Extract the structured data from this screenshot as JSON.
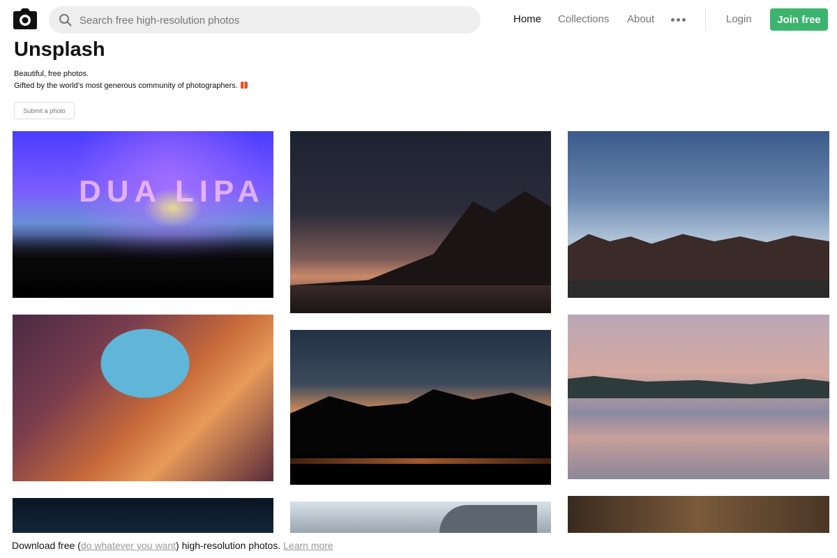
{
  "brand": {
    "icon": "camera-icon"
  },
  "search": {
    "placeholder": "Search free high-resolution photos",
    "icon": "search-icon"
  },
  "nav": {
    "home": "Home",
    "collections": "Collections",
    "about": "About",
    "more_icon": "more-dots-icon",
    "login": "Login",
    "join": "Join free"
  },
  "hero": {
    "title": "Unsplash",
    "line1": "Beautiful, free photos.",
    "line2": "Gifted by the world’s most generous community of photographers.",
    "gift_icon": "gift-icon",
    "submit": "Submit a photo"
  },
  "photos": [
    {
      "subject": "concert-crowd",
      "overlay_text": "DUA LIPA"
    },
    {
      "subject": "milky-way-mountain-lake"
    },
    {
      "subject": "starry-sky-treeline"
    },
    {
      "subject": "antelope-canyon-arch"
    },
    {
      "subject": "mountain-silhouette-sunset-reflection"
    },
    {
      "subject": "lake-bled-island-church"
    },
    {
      "subject": "night-sky"
    },
    {
      "subject": "plane-wreck"
    },
    {
      "subject": "bokeh-warm"
    }
  ],
  "footer": {
    "prefix": "Download free (",
    "link1": "do whatever you want",
    "middle": ") high-resolution photos. ",
    "link2": "Learn more"
  },
  "colors": {
    "join_button": "#3cb46e",
    "muted_text": "#767676"
  }
}
